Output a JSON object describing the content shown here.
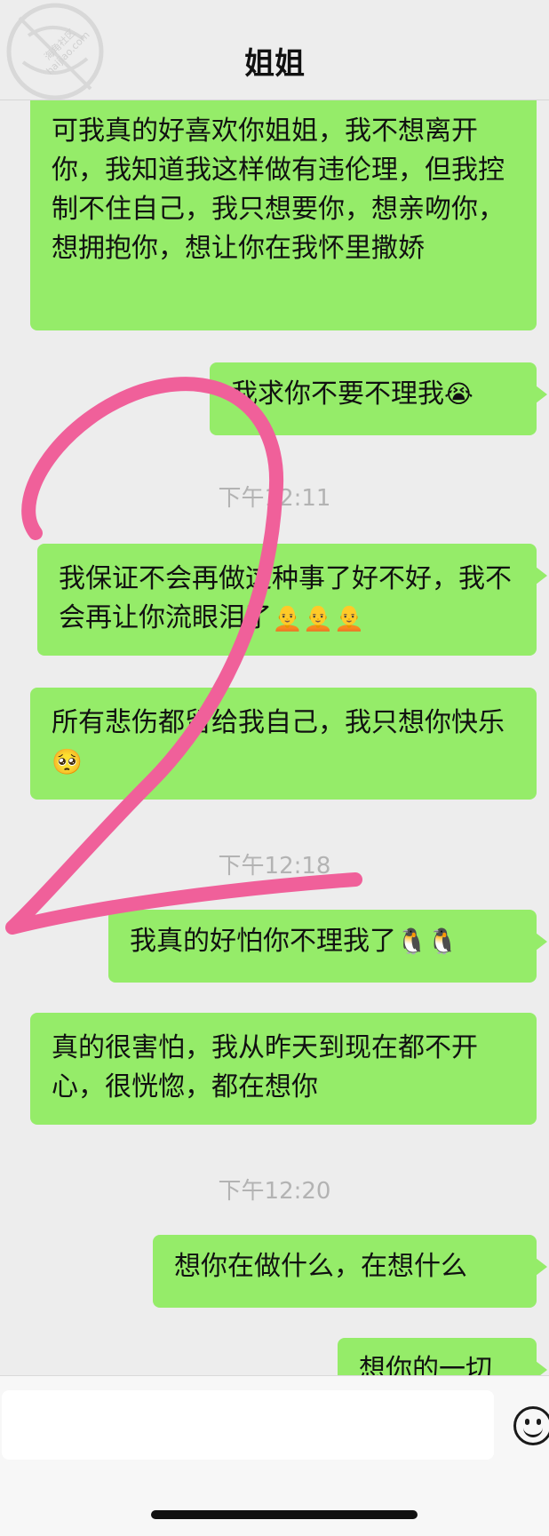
{
  "header": {
    "title": "姐姐"
  },
  "watermark": {
    "line1": "海角社区",
    "line2": "haijiao.com"
  },
  "messages": [
    {
      "text": "可我真的好喜欢你姐姐，我不想离开你，我知道我这样做有违伦理，但我控制不住自己，我只想要你，想亲吻你，想拥抱你，想让你在我怀里撒娇"
    },
    {
      "text": "我求你不要不理我",
      "emoji": "😭"
    },
    {
      "text": "我保证不会再做这种事了好不好，我不会再让你流眼泪了",
      "emoji": "🧑‍🦲🧑‍🦲🧑‍🦲"
    },
    {
      "text": "所有悲伤都留给我自己，我只想你快乐",
      "emoji": "🥺"
    },
    {
      "text": "我真的好怕你不理我了",
      "emoji": "🐧🐧"
    },
    {
      "text": "真的很害怕，我从昨天到现在都不开心，很恍惚，都在想你"
    },
    {
      "text": "想你在做什么，在想什么"
    },
    {
      "text": "想你的一切"
    }
  ],
  "timestamps": [
    "下午12:11",
    "下午12:18",
    "下午12:20"
  ],
  "annotation": {
    "digit": "2",
    "color": "#f0609a"
  },
  "colors": {
    "bubble": "#95ec69",
    "background": "#ededed"
  },
  "icons": {
    "emoji_button": "smiley-face-icon"
  }
}
